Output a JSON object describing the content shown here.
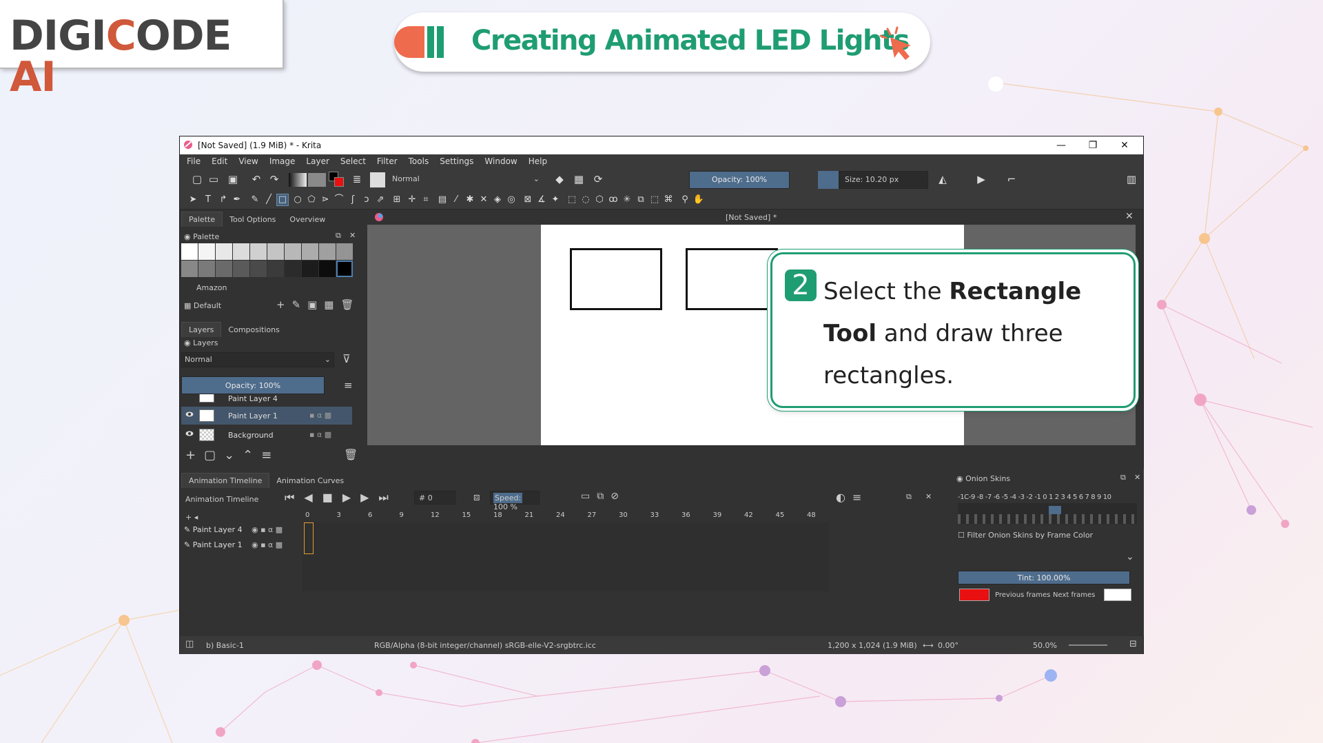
{
  "logo": {
    "part1": "DIGI",
    "part2": "C",
    "part3": "ODE",
    "part4": "AI"
  },
  "banner": {
    "title": "Creating Animated LED Lights"
  },
  "window": {
    "title": "[Not Saved]  (1.9 MiB)  * - Krita",
    "menu": [
      "File",
      "Edit",
      "View",
      "Image",
      "Layer",
      "Select",
      "Filter",
      "Tools",
      "Settings",
      "Window",
      "Help"
    ],
    "blend_mode": "Normal",
    "opacity": "Opacity: 100%",
    "size": "Size: 10.20 px"
  },
  "left_panel": {
    "tabs": [
      "Palette",
      "Tool Options",
      "Overview"
    ],
    "palette_title": "Palette",
    "palette_source": "Amazon",
    "palette_name": "Default",
    "layer_tabs": [
      "Layers",
      "Compositions"
    ],
    "layers_title": "Layers",
    "layer_blend": "Normal",
    "layer_opacity": "Opacity:  100%",
    "layers": [
      {
        "name": "Paint Layer 4",
        "selected": false
      },
      {
        "name": "Paint Layer 1",
        "selected": true
      },
      {
        "name": "Background",
        "selected": false
      }
    ]
  },
  "document": {
    "tab_title": "[Not Saved]  *"
  },
  "callout": {
    "number": "2",
    "pre": "Select the ",
    "bold1": "Rectangle Tool",
    "post": " and draw three rectangles."
  },
  "timeline": {
    "tabs": [
      "Animation Timeline",
      "Animation Curves"
    ],
    "title": "Animation Timeline",
    "frame": "# 0",
    "speed_label": "Speed:",
    "speed_value": "100 %",
    "ruler": [
      "0",
      "3",
      "6",
      "9",
      "12",
      "15",
      "18",
      "21",
      "24",
      "27",
      "30",
      "33",
      "36",
      "39",
      "42",
      "45",
      "48"
    ],
    "rows": [
      "Paint Layer 4",
      "Paint Layer 1"
    ]
  },
  "onion": {
    "title": "Onion Skins",
    "numbers": "-1C-9 -8 -7 -6 -5 -4 -3 -2 -1  0  1 2 3 4 5 6 7 8 9 10",
    "filter": "Filter Onion Skins by Frame Color",
    "tint": "Tint: 100.00%",
    "prev": "Previous frames",
    "next": "Next frames",
    "prev_color": "#e81010",
    "next_color": "#ffffff"
  },
  "status": {
    "brush": "b) Basic-1",
    "color": "RGB/Alpha (8-bit integer/channel)  sRGB-elle-V2-srgbtrc.icc",
    "dims": "1,200 x 1,024 (1.9 MiB)",
    "rotation": "0.00°",
    "zoom": "50.0%"
  },
  "colors": {
    "accent": "#1f9d72",
    "brand": "#d0583b",
    "ui_bg": "#323232",
    "selection": "#43566b"
  }
}
